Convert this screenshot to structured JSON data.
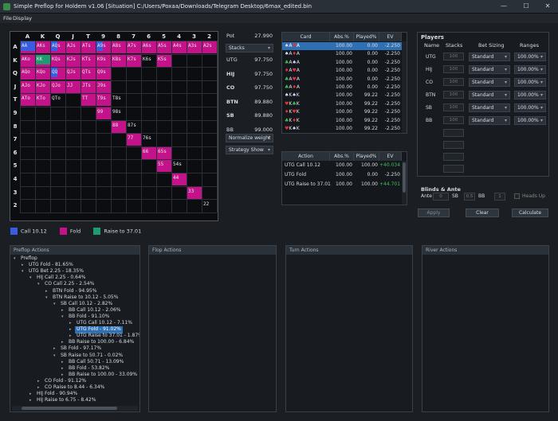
{
  "window": {
    "title": "Simple Preflop for Holdem v1.06 [Situation] C:/Users/Poxaa/Downloads/Telegram Desktop/6max_edited.bin",
    "min": "—",
    "max": "☐",
    "close": "✕"
  },
  "menu": [
    "File",
    "Display"
  ],
  "ranks": [
    "A",
    "K",
    "Q",
    "J",
    "T",
    "9",
    "8",
    "7",
    "6",
    "5",
    "4",
    "3",
    "2"
  ],
  "grid_cells": [
    {
      "r": 0,
      "c": 0,
      "t": "AA",
      "k": "blue"
    },
    {
      "r": 0,
      "c": 1,
      "t": "AKs",
      "k": "pink"
    },
    {
      "r": 0,
      "c": 2,
      "t": "AQs",
      "k": "mix"
    },
    {
      "r": 0,
      "c": 3,
      "t": "AJs",
      "k": "pink"
    },
    {
      "r": 0,
      "c": 4,
      "t": "ATs",
      "k": "pink"
    },
    {
      "r": 0,
      "c": 5,
      "t": "A9s",
      "k": "mix"
    },
    {
      "r": 0,
      "c": 6,
      "t": "A8s",
      "k": "pink"
    },
    {
      "r": 0,
      "c": 7,
      "t": "A7s",
      "k": "pink"
    },
    {
      "r": 0,
      "c": 8,
      "t": "A6s",
      "k": "pink"
    },
    {
      "r": 0,
      "c": 9,
      "t": "A5s",
      "k": "pink"
    },
    {
      "r": 0,
      "c": 10,
      "t": "A4s",
      "k": "pink"
    },
    {
      "r": 0,
      "c": 11,
      "t": "A3s",
      "k": "pink"
    },
    {
      "r": 0,
      "c": 12,
      "t": "A2s",
      "k": "pink"
    },
    {
      "r": 1,
      "c": 0,
      "t": "AKo",
      "k": "pink"
    },
    {
      "r": 1,
      "c": 1,
      "t": "KK",
      "k": "green"
    },
    {
      "r": 1,
      "c": 2,
      "t": "KQs",
      "k": "pink"
    },
    {
      "r": 1,
      "c": 3,
      "t": "KJs",
      "k": "pink"
    },
    {
      "r": 1,
      "c": 4,
      "t": "KTs",
      "k": "pink"
    },
    {
      "r": 1,
      "c": 5,
      "t": "K9s",
      "k": "pink"
    },
    {
      "r": 1,
      "c": 6,
      "t": "K8s",
      "k": "pink"
    },
    {
      "r": 1,
      "c": 7,
      "t": "K7s",
      "k": "pink"
    },
    {
      "r": 1,
      "c": 8,
      "t": "K6s",
      "k": "none"
    },
    {
      "r": 1,
      "c": 9,
      "t": "K5s",
      "k": "pink"
    },
    {
      "r": 2,
      "c": 0,
      "t": "AQo",
      "k": "pink"
    },
    {
      "r": 2,
      "c": 1,
      "t": "KQo",
      "k": "pink"
    },
    {
      "r": 2,
      "c": 2,
      "t": "QQ",
      "k": "mix"
    },
    {
      "r": 2,
      "c": 3,
      "t": "QJs",
      "k": "pink"
    },
    {
      "r": 2,
      "c": 4,
      "t": "QTs",
      "k": "pink"
    },
    {
      "r": 2,
      "c": 5,
      "t": "Q9s",
      "k": "pink"
    },
    {
      "r": 3,
      "c": 0,
      "t": "AJo",
      "k": "pink"
    },
    {
      "r": 3,
      "c": 1,
      "t": "KJo",
      "k": "pink"
    },
    {
      "r": 3,
      "c": 2,
      "t": "QJo",
      "k": "pink"
    },
    {
      "r": 3,
      "c": 3,
      "t": "JJ",
      "k": "pink"
    },
    {
      "r": 3,
      "c": 4,
      "t": "JTs",
      "k": "pink"
    },
    {
      "r": 3,
      "c": 5,
      "t": "J9s",
      "k": "pink"
    },
    {
      "r": 4,
      "c": 0,
      "t": "ATo",
      "k": "pink"
    },
    {
      "r": 4,
      "c": 1,
      "t": "KTo",
      "k": "pink"
    },
    {
      "r": 4,
      "c": 2,
      "t": "QTo",
      "k": "none"
    },
    {
      "r": 4,
      "c": 4,
      "t": "TT",
      "k": "pink"
    },
    {
      "r": 4,
      "c": 5,
      "t": "T9s",
      "k": "pink"
    },
    {
      "r": 4,
      "c": 6,
      "t": "T8s",
      "k": "none"
    },
    {
      "r": 5,
      "c": 5,
      "t": "99",
      "k": "pink"
    },
    {
      "r": 5,
      "c": 6,
      "t": "98s",
      "k": "none"
    },
    {
      "r": 6,
      "c": 6,
      "t": "88",
      "k": "pink"
    },
    {
      "r": 6,
      "c": 7,
      "t": "87s",
      "k": "none"
    },
    {
      "r": 7,
      "c": 7,
      "t": "77",
      "k": "pink"
    },
    {
      "r": 7,
      "c": 8,
      "t": "76s",
      "k": "none"
    },
    {
      "r": 8,
      "c": 8,
      "t": "66",
      "k": "pink"
    },
    {
      "r": 8,
      "c": 9,
      "t": "65s",
      "k": "pink"
    },
    {
      "r": 9,
      "c": 9,
      "t": "55",
      "k": "pink"
    },
    {
      "r": 9,
      "c": 10,
      "t": "54s",
      "k": "none"
    },
    {
      "r": 10,
      "c": 10,
      "t": "44",
      "k": "pink"
    },
    {
      "r": 11,
      "c": 11,
      "t": "33",
      "k": "pink"
    },
    {
      "r": 12,
      "c": 12,
      "t": "22",
      "k": "none"
    }
  ],
  "legend": [
    {
      "label": "Call 10.12",
      "color": "#3a5ce0"
    },
    {
      "label": "Fold",
      "color": "#c4138a"
    },
    {
      "label": "Raise to 37.01",
      "color": "#1f9b72"
    }
  ],
  "pot": {
    "label": "Pot",
    "value": "27.990"
  },
  "stacks_combo": "Stacks",
  "positions": [
    {
      "name": "UTG",
      "value": "97.750",
      "bold": false
    },
    {
      "name": "HIJ",
      "value": "97.750",
      "bold": true
    },
    {
      "name": "CO",
      "value": "97.750",
      "bold": true
    },
    {
      "name": "BTN",
      "value": "89.880",
      "bold": true
    },
    {
      "name": "SB",
      "value": "89.880",
      "bold": true
    },
    {
      "name": "BB",
      "value": "99.000",
      "bold": false
    }
  ],
  "normalize_combo": "Normalize weight",
  "strategy_combo": "Strategy Show",
  "cards_table": {
    "headers": [
      "Card",
      "Abs.%",
      "Played%",
      "EV"
    ],
    "rows": [
      {
        "card": "♠A♥A",
        "abs": "100.00",
        "played": "0.00",
        "ev": "-2.250"
      },
      {
        "card": "♠A♦A",
        "abs": "100.00",
        "played": "0.00",
        "ev": "-2.250"
      },
      {
        "card": "♣A♠A",
        "abs": "100.00",
        "played": "0.00",
        "ev": "-2.250"
      },
      {
        "card": "♦A♥A",
        "abs": "100.00",
        "played": "0.00",
        "ev": "-2.250"
      },
      {
        "card": "♣A♥A",
        "abs": "100.00",
        "played": "0.00",
        "ev": "-2.250"
      },
      {
        "card": "♣A♦A",
        "abs": "100.00",
        "played": "0.00",
        "ev": "-2.250"
      },
      {
        "card": "♠K♠K",
        "abs": "100.00",
        "played": "99.22",
        "ev": "-2.250"
      },
      {
        "card": "♥K♣K",
        "abs": "100.00",
        "played": "99.22",
        "ev": "-2.250"
      },
      {
        "card": "♦K♥K",
        "abs": "100.00",
        "played": "99.22",
        "ev": "-2.250"
      },
      {
        "card": "♣K♦K",
        "abs": "100.00",
        "played": "99.22",
        "ev": "-2.250"
      },
      {
        "card": "♥K♠K",
        "abs": "100.00",
        "played": "99.22",
        "ev": "-2.250"
      }
    ]
  },
  "actions_table": {
    "headers": [
      "Action",
      "Abs.%",
      "Played%",
      "EV"
    ],
    "rows": [
      {
        "action": "UTG Call 10.12",
        "abs": "100.00",
        "played": "100.00",
        "ev": "+40.034",
        "ev_color": "#3fbf5a"
      },
      {
        "action": "UTG Fold",
        "abs": "100.00",
        "played": "0.00",
        "ev": "-2.250",
        "ev_color": "#d8dde3"
      },
      {
        "action": "UTG Raise to 37.01",
        "abs": "100.00",
        "played": "100.00",
        "ev": "+44.701",
        "ev_color": "#3fbf5a"
      }
    ]
  },
  "players": {
    "title": "Players",
    "headers": [
      "Name",
      "Stacks",
      "Bet Sizing",
      "Ranges"
    ],
    "rows": [
      {
        "name": "UTG",
        "stack": "100",
        "sizing": "Standard",
        "range": "100.00%"
      },
      {
        "name": "HIJ",
        "stack": "100",
        "sizing": "Standard",
        "range": "100.00%"
      },
      {
        "name": "CO",
        "stack": "100",
        "sizing": "Standard",
        "range": "100.00%"
      },
      {
        "name": "BTN",
        "stack": "100",
        "sizing": "Standard",
        "range": "100.00%"
      },
      {
        "name": "SB",
        "stack": "100",
        "sizing": "Standard",
        "range": "100.00%"
      },
      {
        "name": "BB",
        "stack": "100",
        "sizing": "Standard",
        "range": "100.00%"
      }
    ]
  },
  "blinds": {
    "title": "Blinds & Ante",
    "ante_label": "Ante",
    "ante": "0",
    "sb_label": "SB",
    "sb": "0.5",
    "bb_label": "BB",
    "bb": "1",
    "heads_up": "Heads Up"
  },
  "buttons": {
    "apply": "Apply",
    "clear": "Clear",
    "calculate": "Calculate"
  },
  "panels": {
    "preflop": "Preflop Actions",
    "flop": "Flop Actions",
    "turn": "Turn Actions",
    "river": "River Actions"
  },
  "tree": [
    {
      "d": 0,
      "t": "Preflop",
      "o": true
    },
    {
      "d": 1,
      "t": "UTG Fold - 81.65%",
      "o": false
    },
    {
      "d": 1,
      "t": "UTG Bet 2.25 - 18.35%",
      "o": true
    },
    {
      "d": 2,
      "t": "HIJ Call 2.25 - 0.64%",
      "o": true
    },
    {
      "d": 3,
      "t": "CO Call 2.25 - 2.54%",
      "o": true
    },
    {
      "d": 4,
      "t": "BTN Fold - 94.95%",
      "o": false
    },
    {
      "d": 4,
      "t": "BTN Raise to 10.12 - 5.05%",
      "o": true
    },
    {
      "d": 5,
      "t": "SB Call 10.12 - 2.82%",
      "o": true
    },
    {
      "d": 6,
      "t": "BB Call 10.12 - 2.06%",
      "o": false
    },
    {
      "d": 6,
      "t": "BB Fold - 91.10%",
      "o": true
    },
    {
      "d": 7,
      "t": "UTG Call 10.12 - 7.11%",
      "o": false
    },
    {
      "d": 7,
      "t": "UTG Fold - 91.02%",
      "o": false,
      "sel": true
    },
    {
      "d": 7,
      "t": "UTG Raise to 37.01 - 1.87%",
      "o": false
    },
    {
      "d": 6,
      "t": "BB Raise to 100.00 - 6.84%",
      "o": false
    },
    {
      "d": 5,
      "t": "SB Fold - 97.17%",
      "o": false
    },
    {
      "d": 5,
      "t": "SB Raise to 50.71 - 0.02%",
      "o": true
    },
    {
      "d": 6,
      "t": "BB Call 50.71 - 13.09%",
      "o": false
    },
    {
      "d": 6,
      "t": "BB Fold - 53.82%",
      "o": false
    },
    {
      "d": 6,
      "t": "BB Raise to 100.00 - 33.09%",
      "o": false
    },
    {
      "d": 3,
      "t": "CO Fold - 91.12%",
      "o": false
    },
    {
      "d": 3,
      "t": "CO Raise to 8.44 - 6.34%",
      "o": false
    },
    {
      "d": 2,
      "t": "HIJ Fold - 90.94%",
      "o": false
    },
    {
      "d": 2,
      "t": "HIJ Raise to 6.75 - 8.42%",
      "o": false
    }
  ],
  "colors": {
    "call": "#3a5ce0",
    "fold": "#c4138a",
    "raise": "#1f9b72",
    "selected": "#2f6fb3"
  }
}
